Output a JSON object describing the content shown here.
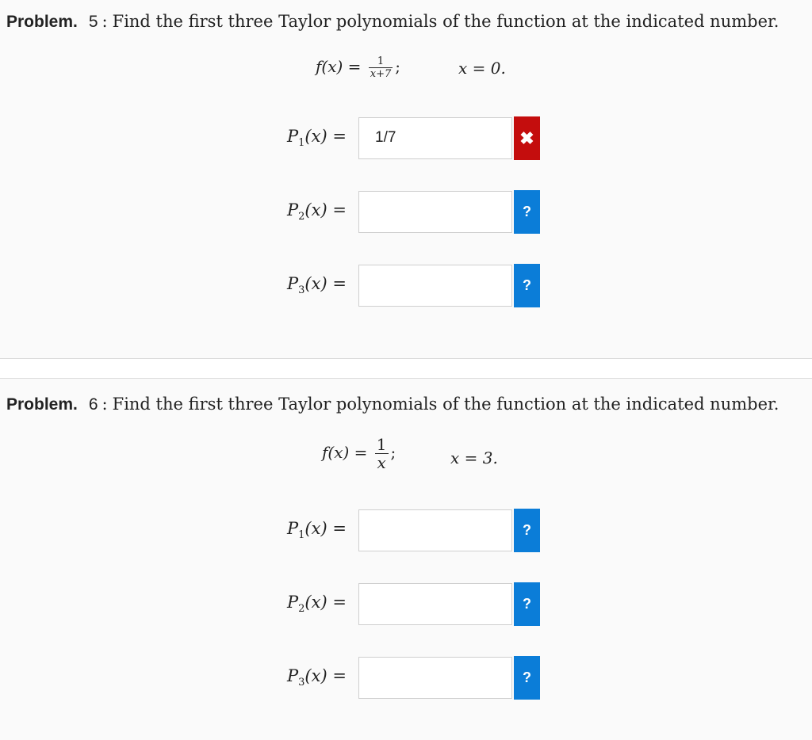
{
  "problems": [
    {
      "label": "Problem.",
      "number": "5",
      "instruction": "Find the first three Taylor polynomials of the function at the indicated number.",
      "function": {
        "lhs": "f(x) =",
        "numerator": "1",
        "denominator": "x+7",
        "suffix": ";",
        "point": "x = 0."
      },
      "rows": [
        {
          "label": "P",
          "sub": "1",
          "tail": "(x) =",
          "value": "1/7",
          "status": "wrong",
          "status_icon": "✖"
        },
        {
          "label": "P",
          "sub": "2",
          "tail": "(x) =",
          "value": "",
          "status": "unknown",
          "status_icon": "?"
        },
        {
          "label": "P",
          "sub": "3",
          "tail": "(x) =",
          "value": "",
          "status": "unknown",
          "status_icon": "?"
        }
      ]
    },
    {
      "label": "Problem.",
      "number": "6",
      "instruction": "Find the first three Taylor polynomials of the function at the indicated number.",
      "function": {
        "lhs": "f(x) =",
        "numerator": "1",
        "denominator": "x",
        "suffix": ";",
        "point": "x = 3."
      },
      "rows": [
        {
          "label": "P",
          "sub": "1",
          "tail": "(x) =",
          "value": "",
          "status": "unknown",
          "status_icon": "?"
        },
        {
          "label": "P",
          "sub": "2",
          "tail": "(x) =",
          "value": "",
          "status": "unknown",
          "status_icon": "?"
        },
        {
          "label": "P",
          "sub": "3",
          "tail": "(x) =",
          "value": "",
          "status": "unknown",
          "status_icon": "?"
        }
      ]
    }
  ],
  "colors": {
    "wrong": "#c40d0d",
    "unknown": "#0b7dd8"
  }
}
